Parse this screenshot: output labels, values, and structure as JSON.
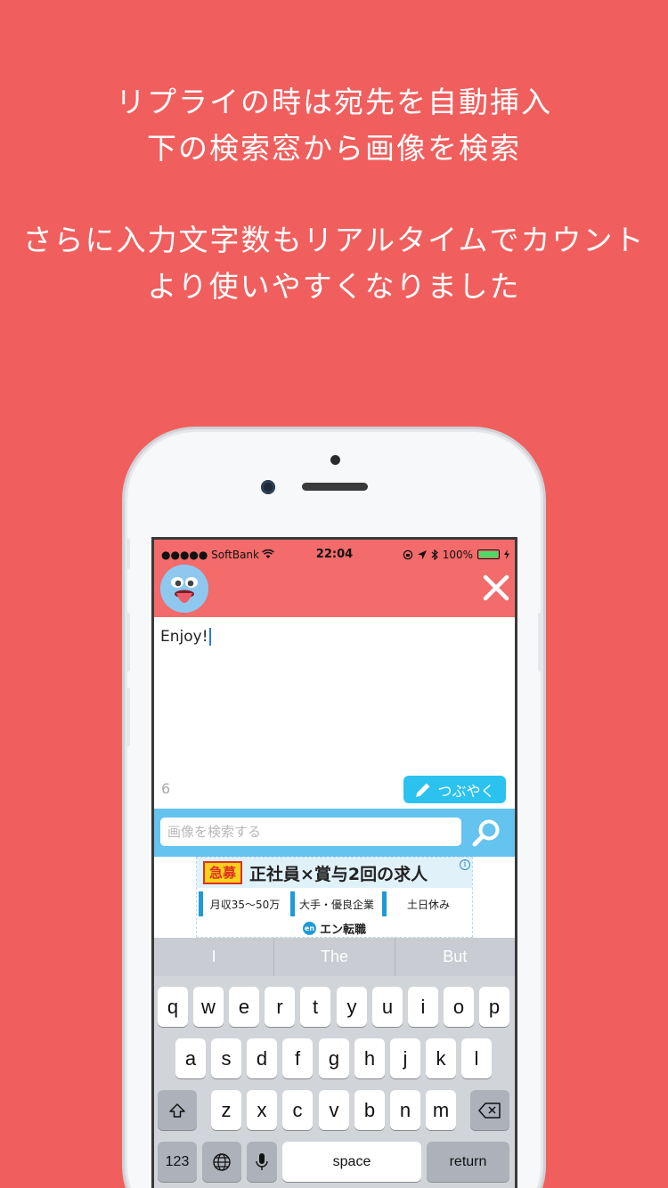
{
  "caption": {
    "line1": "リプライの時は宛先を自動挿入",
    "line2": "下の検索窓から画像を検索",
    "line3": "さらに入力文字数もリアルタイムでカウント",
    "line4": "より使いやすくなりました"
  },
  "status_bar": {
    "carrier": "●●●●● SoftBank",
    "time": "22:04",
    "battery": "100%"
  },
  "compose": {
    "text": "Enjoy!",
    "char_count": "6",
    "tweet_button": "つぶやく"
  },
  "search": {
    "placeholder": "画像を検索する"
  },
  "ad": {
    "badge": "急募",
    "headline": "正社員×賞与2回の求人",
    "chips": [
      "月収35〜50万",
      "大手・優良企業",
      "土日休み"
    ],
    "brand_logo": "en",
    "brand": "エン転職",
    "info": "i"
  },
  "keyboard": {
    "predictions": [
      "I",
      "The",
      "But"
    ],
    "row1": [
      "q",
      "w",
      "e",
      "r",
      "t",
      "y",
      "u",
      "i",
      "o",
      "p"
    ],
    "row2": [
      "a",
      "s",
      "d",
      "f",
      "g",
      "h",
      "j",
      "k",
      "l"
    ],
    "row3": [
      "z",
      "x",
      "c",
      "v",
      "b",
      "n",
      "m"
    ],
    "numbers_key": "123",
    "space_key": "space",
    "return_key": "return"
  },
  "colors": {
    "background": "#F05F5D",
    "header": "#F36B6A",
    "tweet_button": "#2BC2F0",
    "search_bar": "#64C3EF"
  }
}
